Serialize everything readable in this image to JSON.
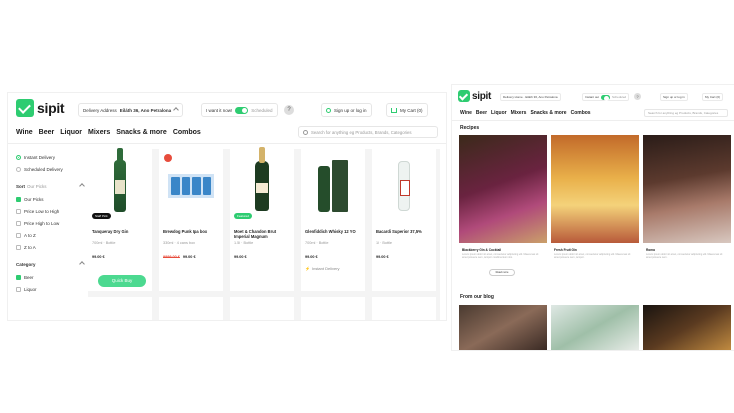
{
  "left": {
    "logo": "sipit",
    "delivery_label": "Delivery Address",
    "delivery_value": "Eiláth 36, Ano Petralona",
    "want_label": "I want it now!",
    "scheduled_label": "Scheduled",
    "help": "?",
    "signup": "Sign up or log in",
    "cart": "My Cart (0)",
    "nav": [
      "Wine",
      "Beer",
      "Liquor",
      "Mixers",
      "Snacks & more",
      "Combos"
    ],
    "search_placeholder": "Search for anything eg Products, Brands, Categories",
    "sidebar": {
      "delivery": [
        "Instant Delivery",
        "Scheduled Delivery"
      ],
      "sort_title": "Sort",
      "sort_sub": "Our Picks",
      "sort_options": [
        "Our Picks",
        "Price Low to High",
        "Price High to Low",
        "A to Z",
        "Z to A"
      ],
      "category_title": "Category",
      "category_options": [
        "Beer",
        "Liquor"
      ]
    },
    "products": [
      {
        "name": "Tanqueray Dry Gin",
        "meta": "700ml · Bottle",
        "price": "99.00 €",
        "old": "",
        "badge": "Staff Pick"
      },
      {
        "name": "Brewdog Punk Ipa box",
        "meta": "330ml · 4 cans box",
        "price": "99.00 €",
        "old": "9999.00 €",
        "badge": ""
      },
      {
        "name": "Moet & Chandon Brut Imperial Magnum",
        "meta": "1.5l · Bottle",
        "price": "99.00 €",
        "old": "",
        "badge": "Featured"
      },
      {
        "name": "Glenfiddich Whisky 12 YO",
        "meta": "700ml · Bottle",
        "price": "99.00 €",
        "old": "",
        "badge": ""
      },
      {
        "name": "Bacardi Superior 37,5%",
        "meta": "1l · Bottle",
        "price": "99.00 €",
        "old": "",
        "badge": ""
      }
    ],
    "quick_buy": "Quick Buy",
    "instant_delivery": "Instant Delivery"
  },
  "right": {
    "logo": "sipit",
    "delivery": "Delivery Home · Eiláth 36, Ano Petralona",
    "want": "Instant out",
    "scheduled": "Scheduled",
    "help": "?",
    "signup": "Sign up or log in",
    "cart": "My Cart (0)",
    "nav": [
      "Wine",
      "Beer",
      "Liquor",
      "Mixers",
      "Snacks & more",
      "Combos"
    ],
    "search_placeholder": "Search for anything eg Products, Brands, Categories",
    "recipes_title": "Recipes",
    "recipes": [
      {
        "name": "Blackberry Gin & Cocktail",
        "desc": "Lorem ipsum dolor sit amet, consectetur adipiscing elit. Maecenas sit amet posuere sem, tempor condimentum nisi."
      },
      {
        "name": "Fresh Fruit Gin",
        "desc": "Lorem ipsum dolor sit amet, consectetur adipiscing elit. Maecenas sit amet posuere sem, tempor."
      },
      {
        "name": "Roma",
        "desc": "Lorem ipsum dolor sit amet, consectetur adipiscing elit. Maecenas sit amet posuere sem."
      }
    ],
    "read_more": "Read more",
    "blog_title": "From our blog"
  }
}
